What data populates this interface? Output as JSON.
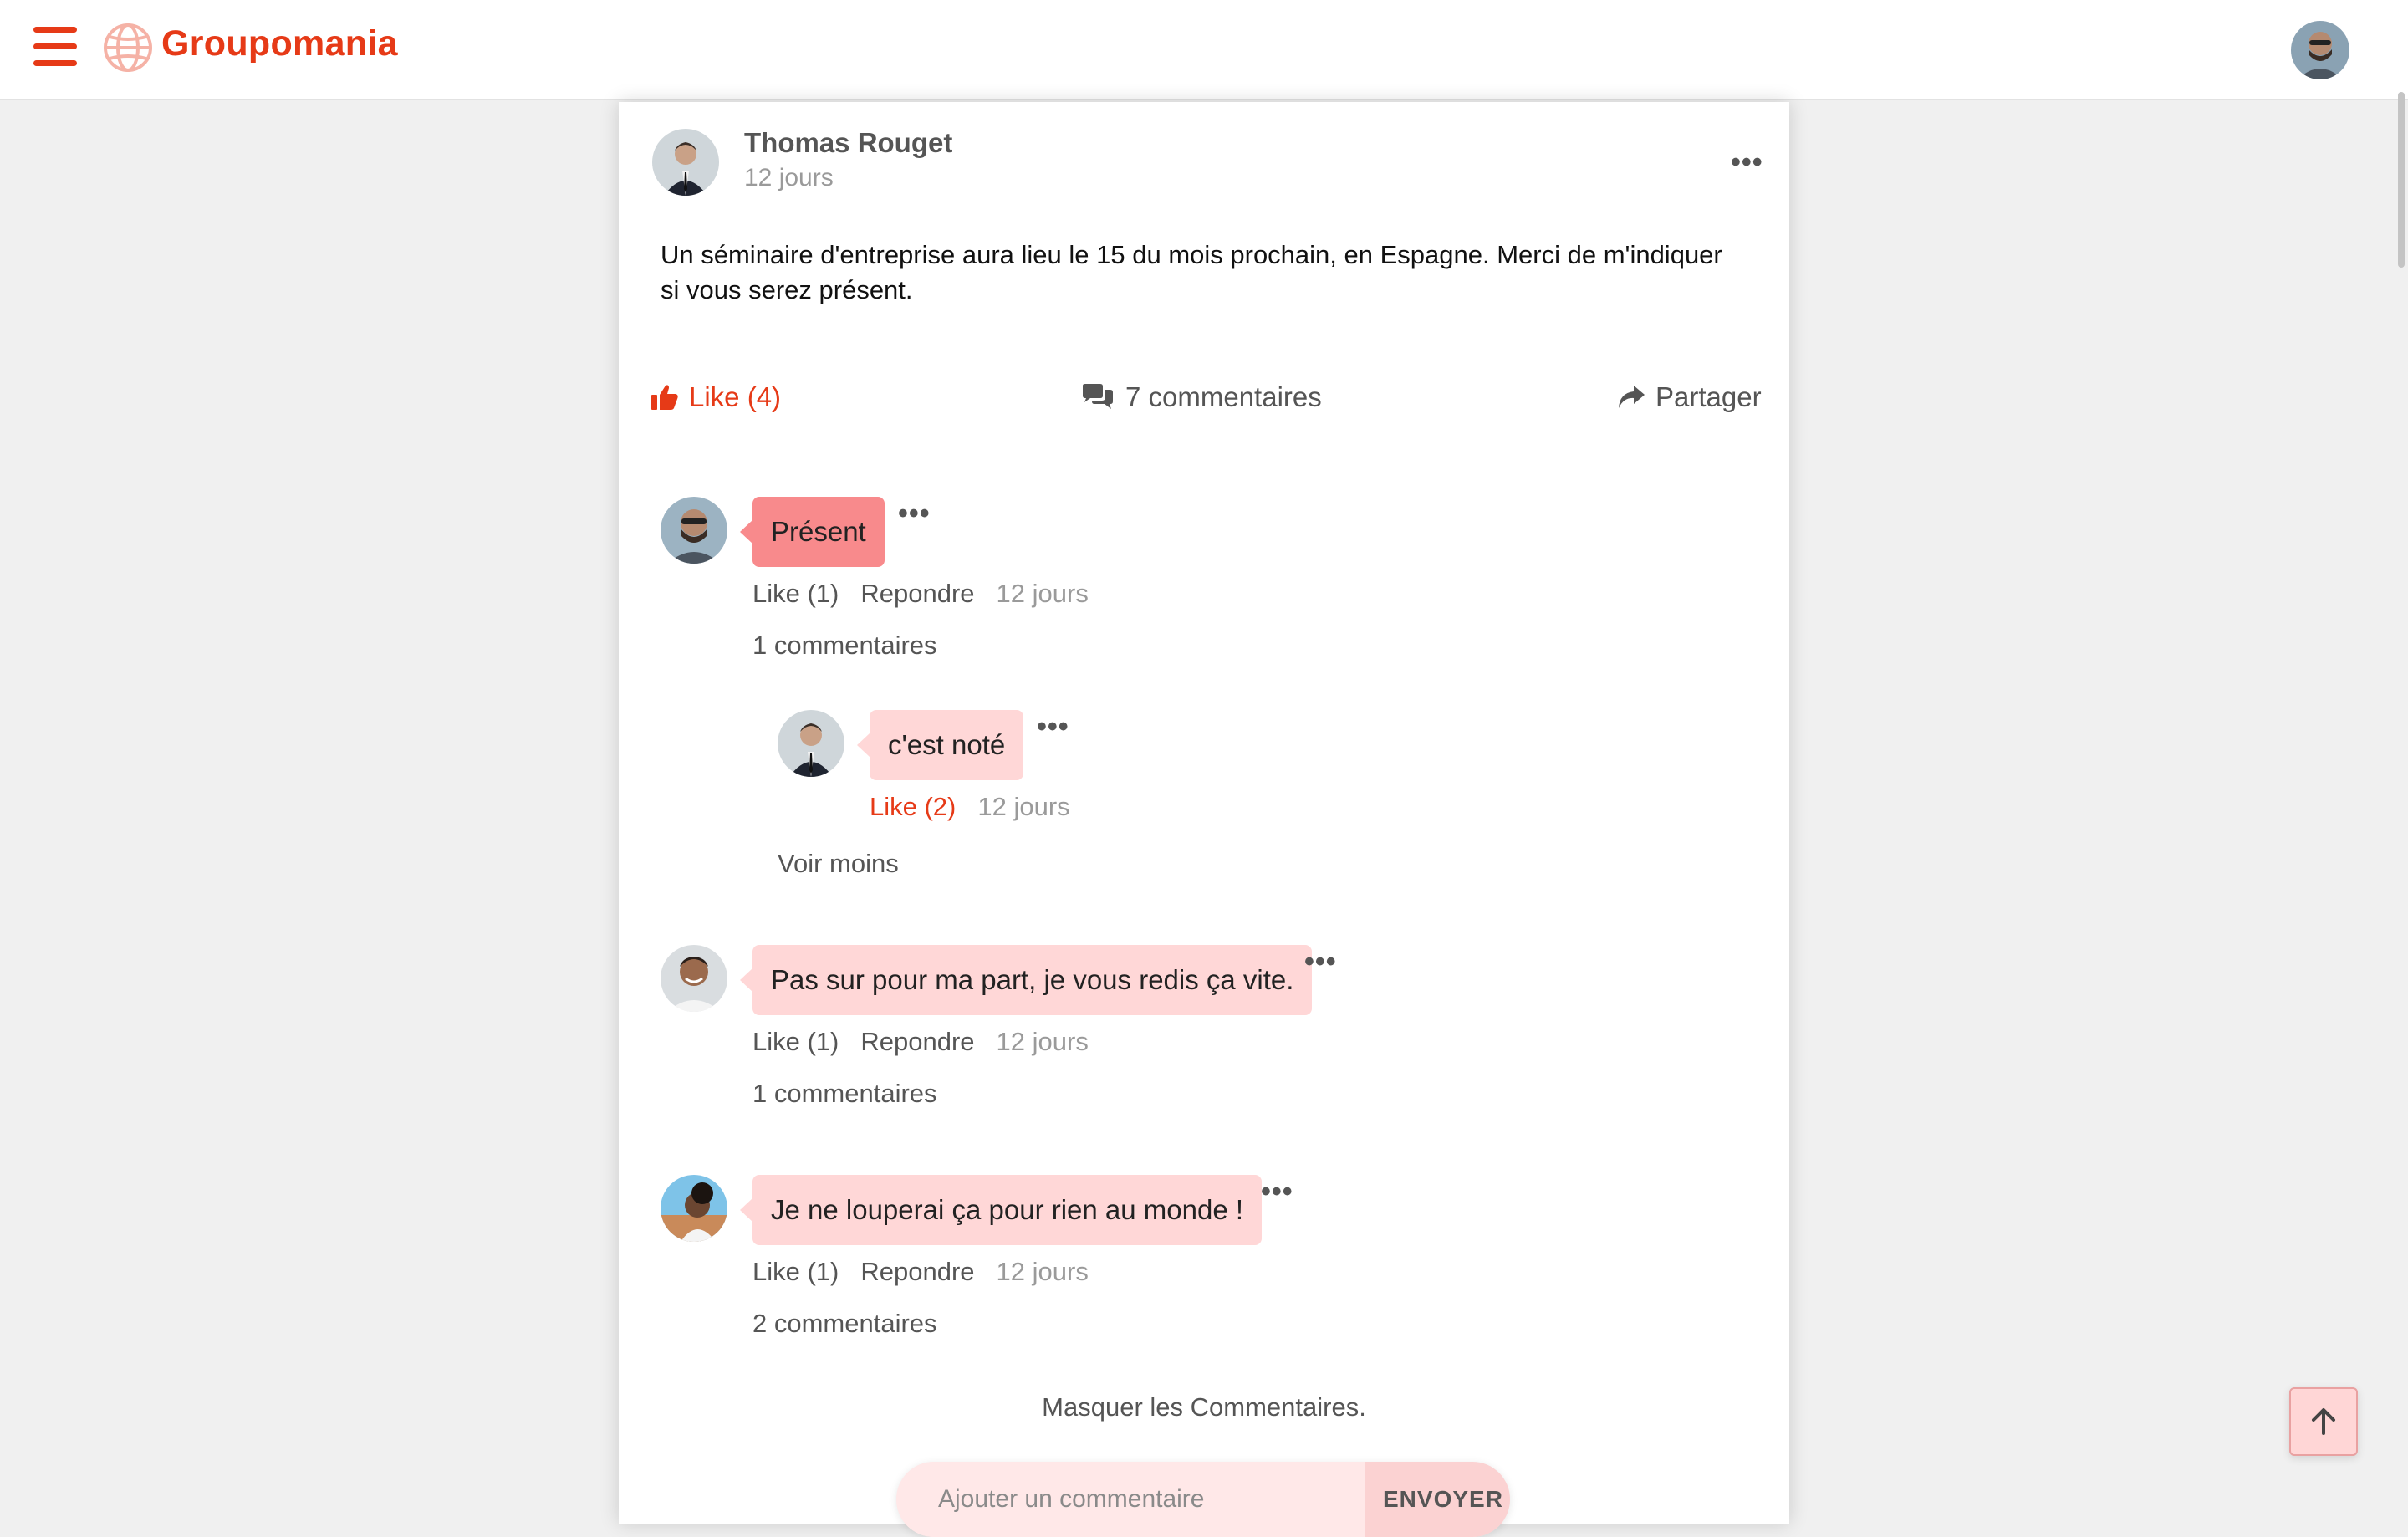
{
  "header": {
    "brand": "Groupomania",
    "menu_icon": "hamburger-menu-icon",
    "logo_icon": "globe-icon",
    "profile_icon": "user-avatar"
  },
  "colors": {
    "accent": "#e63a17",
    "bubble_highlight": "#f88a8c",
    "bubble": "#ffd7d7",
    "background": "#f0f0f0"
  },
  "post": {
    "author": "Thomas Rouget",
    "time": "12 jours",
    "text": "Un séminaire d'entreprise aura lieu le 15 du mois prochain, en Espagne. Merci de m'indiquer si vous serez présent.",
    "options": "•••",
    "actions": {
      "like": "Like (4)",
      "comments": "7 commentaires",
      "share": "Partager"
    }
  },
  "comments": [
    {
      "text": "Présent",
      "like": "Like (1)",
      "reply": "Repondre",
      "time": "12 jours",
      "count": "1 commentaires",
      "options": "•••",
      "replies": [
        {
          "text": "c'est noté",
          "like": "Like (2)",
          "time": "12 jours",
          "options": "•••"
        }
      ],
      "see_less": "Voir moins"
    },
    {
      "text": "Pas sur pour ma part, je vous redis ça vite.",
      "like": "Like (1)",
      "reply": "Repondre",
      "time": "12 jours",
      "count": "1 commentaires",
      "options": "•••"
    },
    {
      "text": "Je ne louperai ça pour rien au monde !",
      "like": "Like (1)",
      "reply": "Repondre",
      "time": "12 jours",
      "count": "2 commentaires",
      "options": "•••"
    }
  ],
  "hide_comments": "Masquer les Commentaires.",
  "comment_form": {
    "placeholder": "Ajouter un commentaire",
    "send": "ENVOYER"
  },
  "scroll_top_icon": "arrow-up-icon"
}
